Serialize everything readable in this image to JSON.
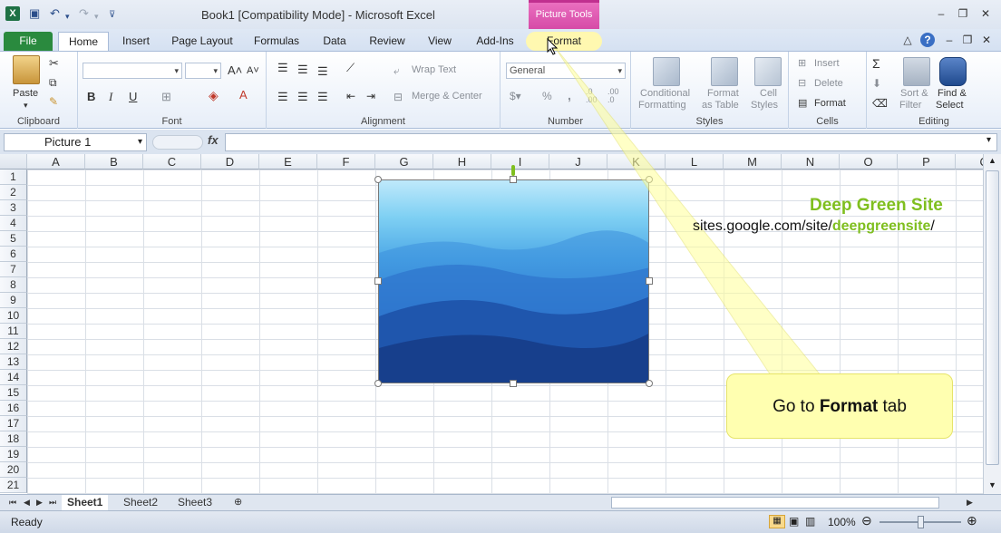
{
  "window": {
    "title": "Book1  [Compatibility Mode]  -  Microsoft Excel",
    "context_tab": "Picture Tools",
    "app_logo": "X"
  },
  "tabs": [
    "File",
    "Home",
    "Insert",
    "Page Layout",
    "Formulas",
    "Data",
    "Review",
    "View",
    "Add-Ins",
    "Format"
  ],
  "ribbon": {
    "clipboard": {
      "paste": "Paste",
      "label": "Clipboard"
    },
    "font": {
      "label": "Font",
      "bold": "B",
      "italic": "I",
      "underline": "U"
    },
    "alignment": {
      "wrap_text": "Wrap Text",
      "merge_center": "Merge & Center",
      "label": "Alignment"
    },
    "number": {
      "format": "General",
      "percent": "%",
      "comma": ",",
      "label": "Number"
    },
    "styles": {
      "conditional": "Conditional",
      "formatting": "Formatting",
      "format": "Format",
      "as_table": "as Table",
      "cell": "Cell",
      "styles_btn": "Styles",
      "label": "Styles"
    },
    "cells": {
      "insert": "Insert",
      "delete": "Delete",
      "format": "Format",
      "label": "Cells"
    },
    "editing": {
      "sort": "Sort &",
      "filter": "Filter",
      "find": "Find &",
      "select": "Select",
      "label": "Editing"
    }
  },
  "formula_bar": {
    "name_box": "Picture 1",
    "fx": "fx",
    "value": ""
  },
  "grid": {
    "columns": [
      "A",
      "B",
      "C",
      "D",
      "E",
      "F",
      "G",
      "H",
      "I",
      "J",
      "K",
      "L",
      "M",
      "N",
      "O",
      "P",
      "Q"
    ],
    "rows": [
      "1",
      "2",
      "3",
      "4",
      "5",
      "6",
      "7",
      "8",
      "9",
      "10",
      "11",
      "12",
      "13",
      "14",
      "15",
      "16",
      "17",
      "18",
      "19",
      "20",
      "21"
    ]
  },
  "overlay": {
    "site_title": "Deep Green Site",
    "site_url_prefix": "sites.google.com/site/",
    "site_url_highlight": "deepgreensite",
    "site_url_suffix": "/",
    "callout_prefix": "Go to ",
    "callout_bold": "Format",
    "callout_suffix": " tab"
  },
  "sheets": [
    "Sheet1",
    "Sheet2",
    "Sheet3"
  ],
  "status": {
    "ready": "Ready",
    "zoom": "100%"
  },
  "colors": {
    "file_tab": "#2a8a3e",
    "context_tab": "#d64aa7",
    "site_green": "#7fbf1f",
    "callout": "#ffffb0"
  }
}
